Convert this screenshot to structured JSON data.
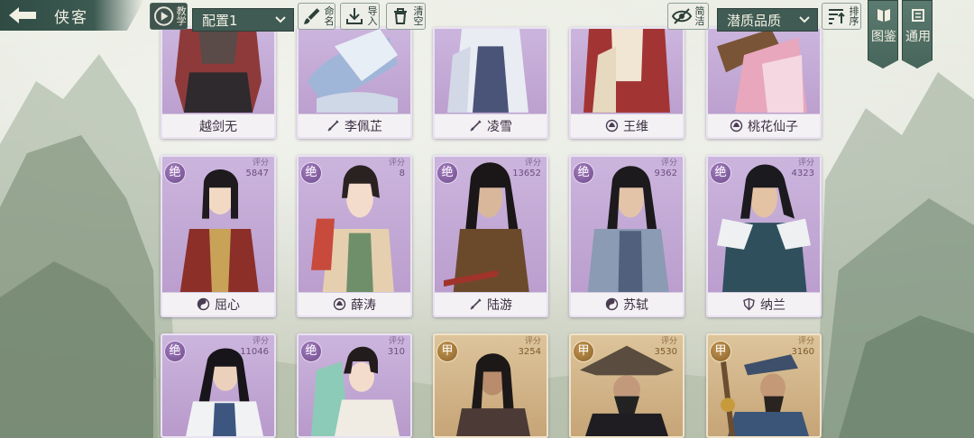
{
  "header": {
    "back_icon": "arrow-left-icon",
    "title": "侠客",
    "tutorial_label": "教学",
    "config_selected": "配置1",
    "rename_label": "命名",
    "import_label": "导入",
    "clear_label": "清空",
    "filter_label": "简洁",
    "sort_selected": "潜质品质",
    "order_label": "排序"
  },
  "side_tabs": {
    "tujian_label": "图鉴",
    "tongyong_label": "通用"
  },
  "score_label": "评分",
  "colors": {
    "panel_dark": "#3f5b53",
    "card_purple": "#b89acb",
    "card_gold": "#c6a577",
    "name_bar": "#f4f1f5"
  },
  "cards": [
    {
      "name": "越剑无",
      "rank": "",
      "score": "",
      "school_icon": "none",
      "tier": "purple"
    },
    {
      "name": "李佩芷",
      "rank": "",
      "score": "",
      "school_icon": "sword-icon",
      "tier": "purple"
    },
    {
      "name": "凌雪",
      "rank": "",
      "score": "",
      "school_icon": "sword-icon",
      "tier": "purple"
    },
    {
      "name": "王维",
      "rank": "",
      "score": "",
      "school_icon": "lotus-icon",
      "tier": "purple"
    },
    {
      "name": "桃花仙子",
      "rank": "",
      "score": "",
      "school_icon": "lotus-icon",
      "tier": "purple"
    },
    {
      "name": "屈心",
      "rank": "绝",
      "score": "5847",
      "school_icon": "taiji-icon",
      "tier": "purple"
    },
    {
      "name": "薛涛",
      "rank": "绝",
      "score": "8",
      "school_icon": "lotus-icon",
      "tier": "purple"
    },
    {
      "name": "陆游",
      "rank": "绝",
      "score": "13652",
      "school_icon": "sword-icon",
      "tier": "purple"
    },
    {
      "name": "苏轼",
      "rank": "绝",
      "score": "9362",
      "school_icon": "taiji-icon",
      "tier": "purple"
    },
    {
      "name": "纳兰",
      "rank": "绝",
      "score": "4323",
      "school_icon": "shield-icon",
      "tier": "purple"
    },
    {
      "name": "",
      "rank": "绝",
      "score": "11046",
      "school_icon": "none",
      "tier": "purple"
    },
    {
      "name": "",
      "rank": "绝",
      "score": "310",
      "school_icon": "none",
      "tier": "purple"
    },
    {
      "name": "",
      "rank": "甲",
      "score": "3254",
      "school_icon": "none",
      "tier": "gold"
    },
    {
      "name": "",
      "rank": "甲",
      "score": "3530",
      "school_icon": "none",
      "tier": "gold"
    },
    {
      "name": "",
      "rank": "甲",
      "score": "3160",
      "school_icon": "none",
      "tier": "gold"
    }
  ]
}
